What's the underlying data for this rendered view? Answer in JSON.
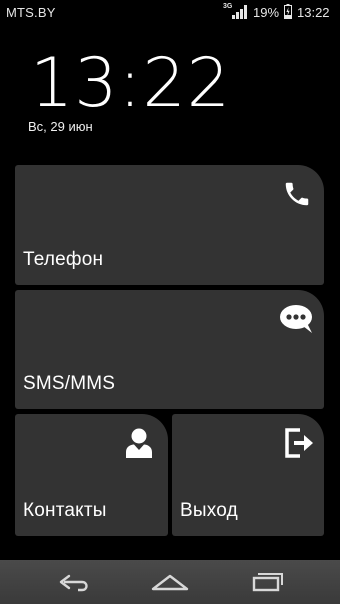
{
  "status_bar": {
    "carrier": "MTS.BY",
    "network_type": "3G",
    "battery_percent": "19%",
    "time": "13:22",
    "icons": [
      "signal-icon",
      "battery-charging-icon"
    ]
  },
  "lockscreen": {
    "clock": "13:22",
    "date": "Вс, 29 июн"
  },
  "tiles": {
    "phone": {
      "label": "Телефон",
      "icon": "phone-icon"
    },
    "sms": {
      "label": "SMS/MMS",
      "icon": "chat-bubble-icon"
    },
    "contacts": {
      "label": "Контакты",
      "icon": "person-icon"
    },
    "exit": {
      "label": "Выход",
      "icon": "exit-icon"
    }
  },
  "nav_bar": {
    "buttons": [
      "back-icon",
      "home-icon",
      "recent-apps-icon"
    ]
  },
  "colors": {
    "background": "#000000",
    "tile": "#333333",
    "nav_bar": "#404040",
    "text": "#ffffff"
  }
}
